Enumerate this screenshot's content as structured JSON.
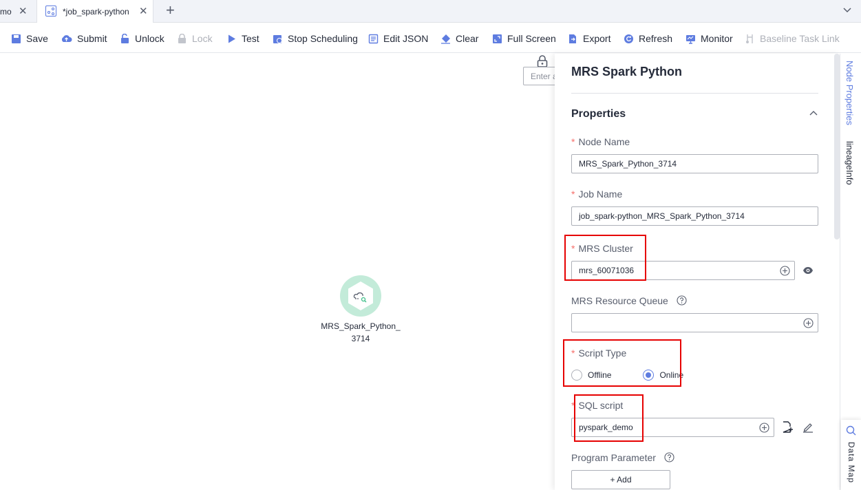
{
  "tabs": [
    {
      "label": "mo",
      "close_icon": "close-icon"
    },
    {
      "label": "*job_spark-python",
      "icon": "workflow-icon",
      "close_icon": "close-icon"
    }
  ],
  "toolbar": {
    "save": "Save",
    "submit": "Submit",
    "unlock": "Unlock",
    "lock": "Lock",
    "test": "Test",
    "stop_scheduling": "Stop Scheduling",
    "edit_json": "Edit JSON",
    "clear": "Clear",
    "full_screen": "Full Screen",
    "export": "Export",
    "refresh": "Refresh",
    "monitor": "Monitor",
    "baseline_task_link": "Baseline Task Link"
  },
  "canvas": {
    "search_placeholder": "Enter a",
    "node": {
      "label": "MRS_Spark_Python_ 3714",
      "icon": "spark-python-icon"
    }
  },
  "panel": {
    "title": "MRS Spark Python",
    "section": "Properties",
    "node_name": {
      "label": "Node Name",
      "value": "MRS_Spark_Python_3714"
    },
    "job_name": {
      "label": "Job Name",
      "value": "job_spark-python_MRS_Spark_Python_3714"
    },
    "mrs_cluster": {
      "label": "MRS Cluster",
      "value": "mrs_60071036"
    },
    "resource_queue": {
      "label": "MRS Resource Queue",
      "value": ""
    },
    "script_type": {
      "label": "Script Type",
      "options": [
        "Offline",
        "Online"
      ],
      "selected": "Online"
    },
    "sql_script": {
      "label": "SQL script",
      "value": "pyspark_demo"
    },
    "program_parameter": {
      "label": "Program Parameter",
      "add_label": "+ Add"
    }
  },
  "rail": {
    "node_properties": "Node Properties",
    "lineage_info": "lineageInfo",
    "data_map": "Data Map"
  },
  "colors": {
    "accent": "#5e7ce0",
    "highlight": "#e60000",
    "required": "#f66f6a",
    "node_ring": "#c3ebd9"
  }
}
